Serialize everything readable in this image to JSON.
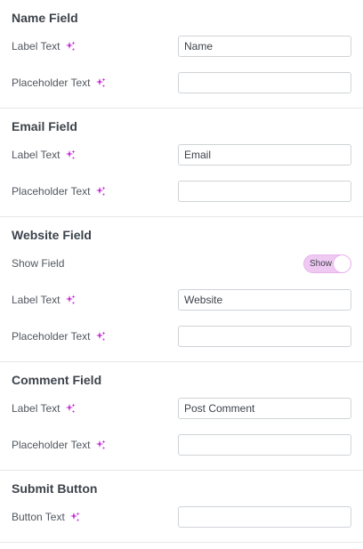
{
  "colors": {
    "accent": "#c32bd3",
    "toggle_bg": "#f0c9f3"
  },
  "icons": {
    "ai": "sparkle-icon"
  },
  "sections": [
    {
      "title": "Name Field",
      "label_text_label": "Label Text",
      "label_text_value": "Name",
      "placeholder_text_label": "Placeholder Text",
      "placeholder_text_value": ""
    },
    {
      "title": "Email Field",
      "label_text_label": "Label Text",
      "label_text_value": "Email",
      "placeholder_text_label": "Placeholder Text",
      "placeholder_text_value": ""
    },
    {
      "title": "Website Field",
      "show_field_label": "Show Field",
      "show_toggle_label": "Show",
      "show_toggle_on": true,
      "label_text_label": "Label Text",
      "label_text_value": "Website",
      "placeholder_text_label": "Placeholder Text",
      "placeholder_text_value": ""
    },
    {
      "title": "Comment Field",
      "label_text_label": "Label Text",
      "label_text_value": "Post Comment",
      "placeholder_text_label": "Placeholder Text",
      "placeholder_text_value": ""
    },
    {
      "title": "Submit Button",
      "button_text_label": "Button Text",
      "button_text_value": ""
    }
  ]
}
